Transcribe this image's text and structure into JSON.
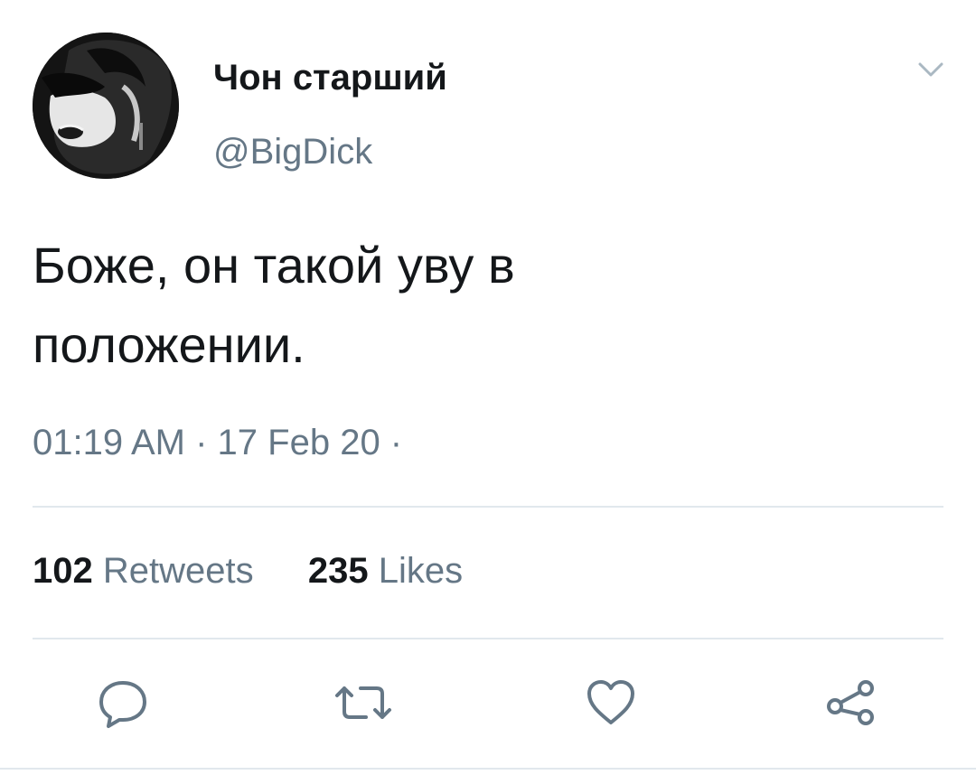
{
  "tweet": {
    "display_name": "Чон старший",
    "handle": "@BigDick",
    "text_line1": "Боже, он такой уву в",
    "text_line2": "положении.",
    "timestamp": "01:19 AM · 17 Feb 20 ·",
    "retweets_count": "102",
    "retweets_label": "Retweets",
    "likes_count": "235",
    "likes_label": "Likes"
  },
  "icons": {
    "menu": "chevron-down-icon",
    "reply": "reply-icon",
    "retweet": "retweet-icon",
    "like": "heart-icon",
    "share": "share-icon"
  },
  "colors": {
    "text": "#14171a",
    "secondary": "#657786",
    "divider": "#e1e8ed"
  }
}
